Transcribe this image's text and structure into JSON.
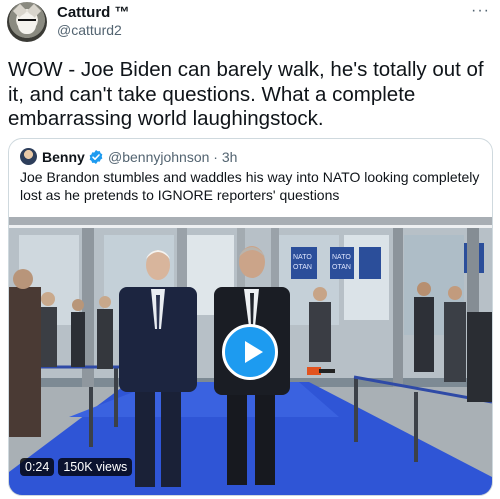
{
  "colors": {
    "accent": "#1d9bf0",
    "text": "#0f1419",
    "muted": "#536471",
    "border": "#cfd9de",
    "carpet": "#2f55d6"
  },
  "tweet": {
    "display_name": "Catturd ™",
    "handle": "@catturd2",
    "more_icon": "ellipsis-icon",
    "text": "WOW - Joe Biden can barely walk, he's totally out of it, and can't take questions. What a complete embarrassing world laughingstock."
  },
  "quote": {
    "display_name": "Benny",
    "verified_icon": "verified-badge-icon",
    "handle": "@bennyjohnson",
    "separator": "·",
    "time": "3h",
    "text": "Joe Brandon stumbles and waddles his way into NATO looking completely lost as he pretends to IGNORE reporters' questions",
    "video": {
      "duration": "0:24",
      "views": "150K views",
      "play_icon": "play-icon"
    }
  }
}
